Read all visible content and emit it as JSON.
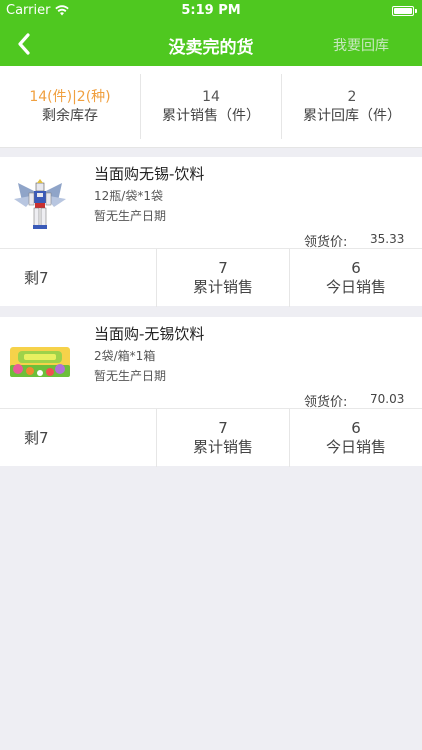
{
  "status_bar": {
    "carrier": "Carrier",
    "time": "5:19 PM"
  },
  "nav": {
    "title": "没卖完的货",
    "right_action": "我要回库"
  },
  "summary": [
    {
      "value": "14(件)|2(种)",
      "label": "剩余库存",
      "highlight": true
    },
    {
      "value": "14",
      "label": "累计销售（件）",
      "highlight": false
    },
    {
      "value": "2",
      "label": "累计回库（件）",
      "highlight": false
    }
  ],
  "products": [
    {
      "name": "当面购无锡-饮料",
      "spec": "12瓶/袋*1袋",
      "date": "暂无生产日期",
      "price_label": "领货价:",
      "price": "35.33",
      "remaining": "剩7",
      "total_sales": "7",
      "total_sales_label": "累计销售",
      "today_sales": "6",
      "today_sales_label": "今日销售",
      "image_icon": "robot-figure-icon"
    },
    {
      "name": "当面购-无锡饮料",
      "spec": "2袋/箱*1箱",
      "date": "暂无生产日期",
      "price_label": "领货价:",
      "price": "70.03",
      "remaining": "剩7",
      "total_sales": "7",
      "total_sales_label": "累计销售",
      "today_sales": "6",
      "today_sales_label": "今日销售",
      "image_icon": "garden-banner-icon"
    }
  ],
  "colors": {
    "brand_green": "#4fc820",
    "highlight_orange": "#f0a040",
    "background": "#eeeef3"
  }
}
